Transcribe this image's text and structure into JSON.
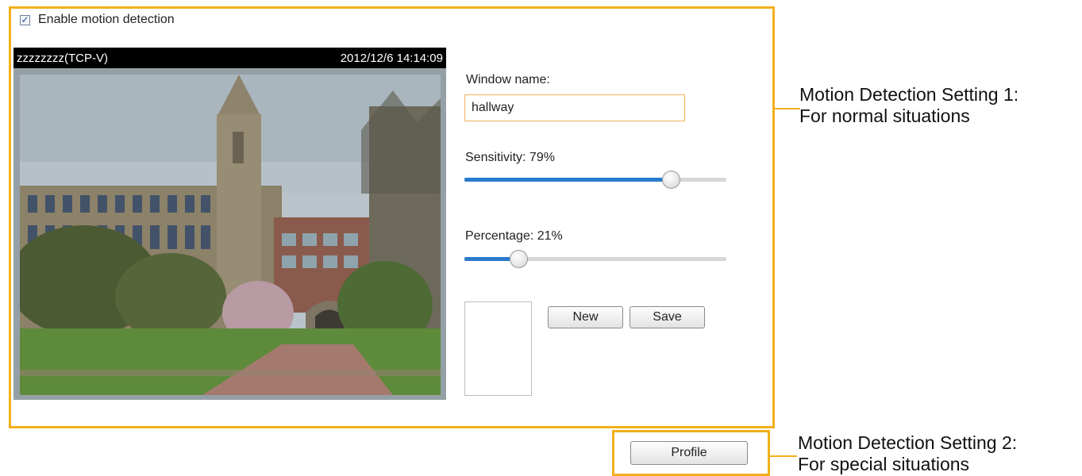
{
  "motion_detection": {
    "enable_label": "Enable motion detection",
    "enabled": true
  },
  "video": {
    "stream_name": "zzzzzzzz(TCP-V)",
    "timestamp": "2012/12/6 14:14:09"
  },
  "window_settings": {
    "window_name_label": "Window name:",
    "window_name_value": "hallway",
    "sensitivity_label": "Sensitivity: 79%",
    "sensitivity_value": 79,
    "percentage_label": "Percentage: 21%",
    "percentage_value": 21
  },
  "buttons": {
    "new_label": "New",
    "save_label": "Save",
    "profile_label": "Profile"
  },
  "callouts": {
    "setting1_line1": "Motion Detection Setting 1:",
    "setting1_line2": "For normal situations",
    "setting2_line1": "Motion Detection Setting 2:",
    "setting2_line2": "For special situations"
  },
  "colors": {
    "highlight_frame": "#f3b01c",
    "slider_fill": "#2b7bcc"
  },
  "icons": {
    "checkbox": "check-icon"
  }
}
